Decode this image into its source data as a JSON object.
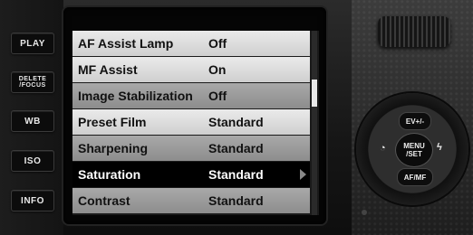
{
  "side_buttons": [
    "PLAY",
    "DELETE\n/FOCUS",
    "WB",
    "ISO",
    "INFO"
  ],
  "menu": {
    "rows": [
      {
        "label": "AF Assist Lamp",
        "value": "Off"
      },
      {
        "label": "MF Assist",
        "value": "On"
      },
      {
        "label": "Image Stabilization",
        "value": "Off"
      },
      {
        "label": "Preset Film",
        "value": "Standard"
      },
      {
        "label": "Sharpening",
        "value": "Standard"
      },
      {
        "label": "Saturation",
        "value": "Standard"
      },
      {
        "label": "Contrast",
        "value": "Standard"
      }
    ],
    "selected": "Saturation"
  },
  "controls": {
    "ev": "EV+/-",
    "menu_set": "MENU\n/SET",
    "af_mf": "AF/MF",
    "timer_icon": "self-timer-icon",
    "flash_icon": "flash-icon"
  }
}
